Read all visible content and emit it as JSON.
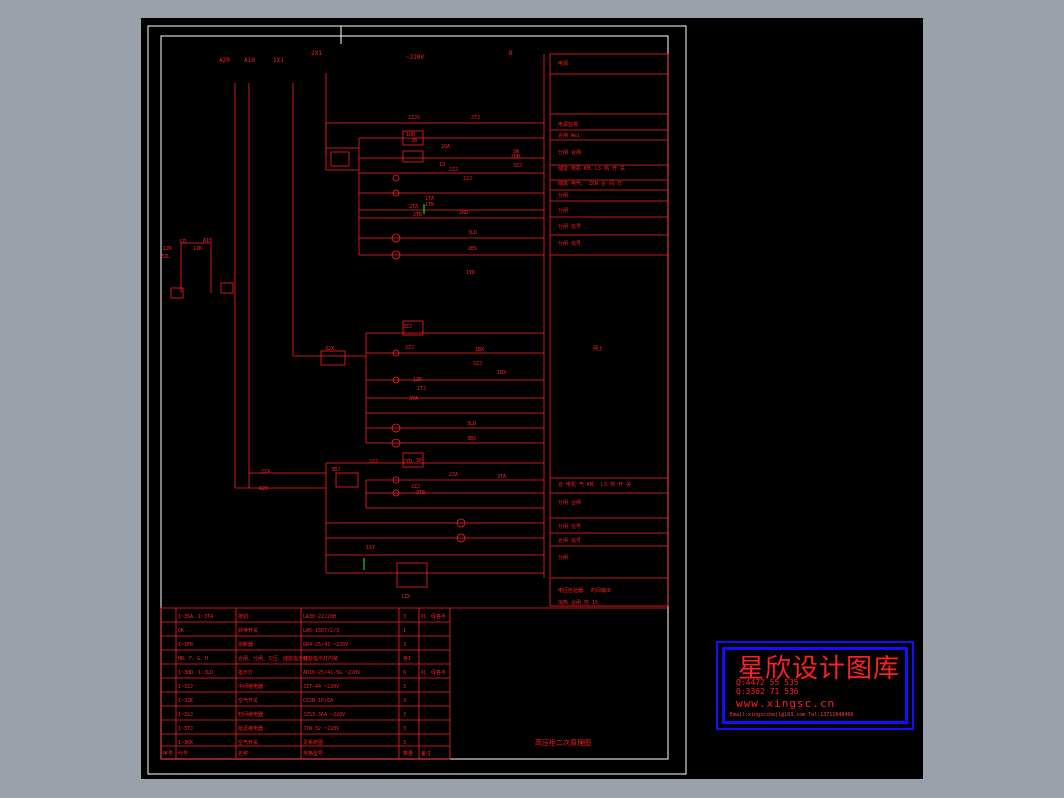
{
  "colors": {
    "background": "#9aa1aa",
    "sheet": "#000000",
    "line": "#ff2020",
    "frame": "#ffffff",
    "logo_border": "#1010ff"
  },
  "top_labels": [
    "A20",
    "A10",
    "1X1",
    "2X1",
    "~220V",
    "B"
  ],
  "notes": [
    "电源",
    "电源监视",
    "合闸 Wei",
    "分闸 合闸",
    "储能 电机 KM、LS 热 开 关",
    "储能 电气、 ZCN 合 间 灯",
    "分闸",
    "分闸",
    "分闸 信号",
    "分闸 信号",
    "网上",
    "合 电机 气 KM、 LS 热 开 关",
    "分闸 合闸",
    "分闸 信号",
    "合闸 信号",
    "分闸",
    "电压检验器、 时间输出",
    "加热 合闸 控 1%"
  ],
  "circuit_labels": [
    "2ZJS",
    "2TJ",
    "1QR",
    "3B",
    "2QA",
    "1Q",
    "2ZJ",
    "22J",
    "1TA",
    "1TB",
    "SW",
    "3ZJ",
    "2DB",
    "2TA",
    "2TB",
    "2RD",
    "3LD",
    "2BS",
    "1YD",
    "3ZJ",
    "32X",
    "1BX",
    "1BX",
    "SZJ",
    "2ZJ",
    "1ZK",
    "2TJ",
    "3YA",
    "3LD",
    "3BS",
    "2YD",
    "3P",
    "2ZA",
    "3TB",
    "3TA",
    "2ZJ",
    "3BJ",
    "3ZJ",
    "1SY",
    "1ZX",
    "2ZX",
    "A20",
    "A10",
    "1ZK",
    "1ZK",
    "3ZL",
    "SZL"
  ],
  "parts_table": {
    "header": [
      "序号",
      "代号",
      "名称",
      "规格型号",
      "数量",
      "备注"
    ],
    "rows": [
      [
        "",
        "1~3SA、1~3TA",
        "按钮",
        "LA38-22/20H",
        "3",
        "红、绿各半"
      ],
      [
        "",
        "QK",
        "转换开关",
        "LW5-15D7/2/3",
        "1",
        ""
      ],
      [
        "",
        "1~3FR",
        "熔断器",
        "GR4-25/41 ~220V",
        "3",
        ""
      ],
      [
        "",
        "HR、F、G、H",
        "合闸、分闸、欠压、储能指示灯",
        "储能指示灯内装",
        "各1",
        ""
      ],
      [
        "",
        "1~3HD、1~3LD",
        "指示灯",
        "AD16-25/41-5G ~220V",
        "6",
        "红、绿各半"
      ],
      [
        "",
        "1~3ZJ",
        "中间继电器",
        "JZ7-44 ~220V",
        "3",
        ""
      ],
      [
        "",
        "1~3ZK",
        "空气开关",
        "C65N-1P/6A",
        "3",
        ""
      ],
      [
        "",
        "1~3SJ",
        "时间继电器",
        "JZS3-36A ~220V",
        "3",
        ""
      ],
      [
        "",
        "1~3TJ",
        "延迟继电器",
        "JTW-32 ~220V",
        "3",
        ""
      ],
      [
        "",
        "1~3KK",
        "空气开关",
        "见系统图",
        "3",
        ""
      ]
    ]
  },
  "drawing_title": "高压柜二次原理图",
  "logo": {
    "title": "星欣设计图库",
    "qq1": "Q:4472 55 535",
    "qq2": "Q:3362 71 536",
    "url": "www.xingsc.cn",
    "contact": "Email:xingscsheji@163.com  Tel:13711648466"
  }
}
